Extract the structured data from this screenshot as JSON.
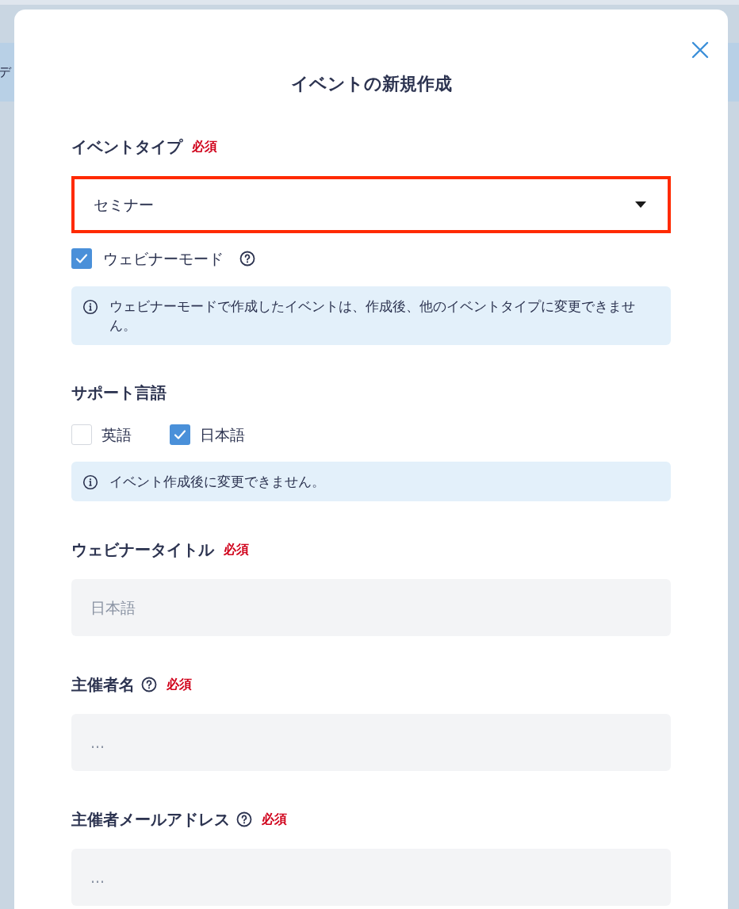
{
  "background": {
    "partial_text": "デ"
  },
  "dialog": {
    "title": "イベントの新規作成"
  },
  "fields": [
    {
      "kind": "select",
      "label": "イベントタイプ",
      "help": false,
      "required": "必須",
      "value": "セミナー",
      "highlighted": true
    },
    {
      "kind": "checkbox",
      "label": "ウェビナーモード",
      "checked": true,
      "help": true
    },
    {
      "kind": "notice",
      "text": "ウェビナーモードで作成したイベントは、作成後、他のイベントタイプに変更できません。"
    },
    {
      "kind": "checkbox_group",
      "label": "サポート言語",
      "options": [
        {
          "label": "英語",
          "checked": false
        },
        {
          "label": "日本語",
          "checked": true
        }
      ]
    },
    {
      "kind": "notice",
      "text": "イベント作成後に変更できません。"
    },
    {
      "kind": "text",
      "label": "ウェビナータイトル",
      "help": false,
      "required": "必須",
      "placeholder": "日本語"
    },
    {
      "kind": "text",
      "label": "主催者名",
      "help": true,
      "required": "必須",
      "placeholder": "..."
    },
    {
      "kind": "text",
      "label": "主催者メールアドレス",
      "help": true,
      "required": "必須",
      "placeholder": "..."
    }
  ]
}
